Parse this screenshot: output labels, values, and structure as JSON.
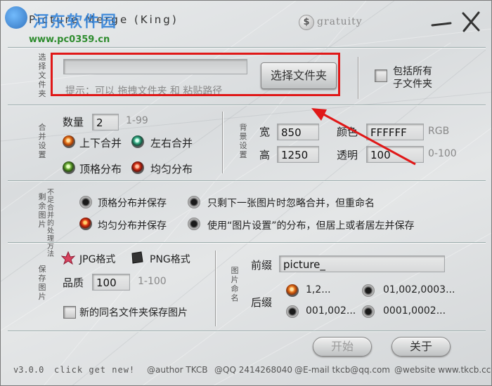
{
  "window": {
    "title": "Picture Merge (King)",
    "watermark_name": "河东软件园",
    "watermark_url": "www.pc0359.cn",
    "gratuity_icon": "$",
    "gratuity_label": "gratuity",
    "minimize_icon": "minimize-icon",
    "close_icon": "close-icon"
  },
  "folder": {
    "section_label": "选择文件夹",
    "path_value": "",
    "choose_button": "选择文件夹",
    "hint": "提示：可以 拖拽文件夹 和 粘贴路径",
    "include_sub_label_1": "包括所有",
    "include_sub_label_2": "子文件夹",
    "include_sub_checked": false
  },
  "merge": {
    "section_label": "合并设置",
    "count_label": "数量",
    "count_value": "2",
    "count_range": "1-99",
    "options": [
      {
        "label": "上下合并",
        "style": "sel-orange"
      },
      {
        "label": "左右合并",
        "style": "teal"
      },
      {
        "label": "顶格分布",
        "style": "green"
      },
      {
        "label": "均匀分布",
        "style": "red2"
      }
    ]
  },
  "background": {
    "section_label": "背景设置",
    "width_label": "宽",
    "width_value": "850",
    "height_label": "高",
    "height_value": "1250",
    "color_label": "颜色",
    "color_value": "FFFFFF",
    "color_unit": "RGB",
    "opacity_label": "透明",
    "opacity_value": "100",
    "opacity_range": "0-100"
  },
  "remaining": {
    "section_label_a": "剩余图片",
    "section_label_b": "不足合并的处理方法",
    "options": [
      {
        "label": "顶格分布并保存",
        "selected": false
      },
      {
        "label": "只剩下一张图片时忽略合并，但重命名",
        "selected": false
      },
      {
        "label": "均匀分布并保存",
        "selected": true
      },
      {
        "label": "使用“图片设置”的分布，但居上或者居左并保存",
        "selected": false
      }
    ]
  },
  "save": {
    "section_label": "保存图片",
    "jpg_label": "JPG格式",
    "png_label": "PNG格式",
    "quality_label": "品质",
    "quality_value": "100",
    "quality_range": "1-100",
    "new_folder_label": "新的同名文件夹保存图片",
    "new_folder_checked": false
  },
  "naming": {
    "section_label": "图片命名",
    "prefix_label": "前缀",
    "prefix_value": "picture_",
    "suffix_label": "后缀",
    "suffix_options": [
      "1,2...",
      "01,002,0003...",
      "001,002...",
      "0001,0002..."
    ],
    "suffix_selected": 0
  },
  "actions": {
    "start_label": "开始",
    "about_label": "关于"
  },
  "footer": {
    "version": "v3.0.0",
    "click_new": "click get new!",
    "author": "@author TKCB",
    "qq": "@QQ 2414268040",
    "email": "@E-mail tkcb@qq.com",
    "website": "@website www.tkcb.cc"
  },
  "colors": {
    "annotation": "#e01818",
    "watermark_blue": "#2c7fd8",
    "watermark_green": "#2e8c2e"
  }
}
